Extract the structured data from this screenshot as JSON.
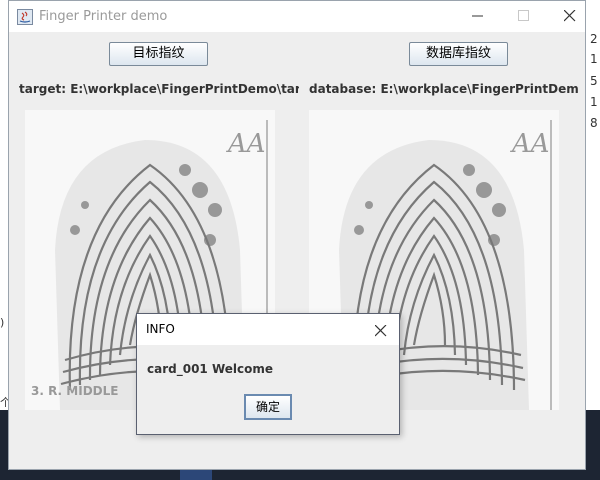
{
  "window": {
    "title": "Finger Printer demo"
  },
  "buttons": {
    "target": "目标指纹",
    "database": "数据库指纹"
  },
  "paths": {
    "target": "target: E:\\workplace\\FingerPrintDemo\\target.png",
    "database": "database: E:\\workplace\\FingerPrintDemo\\data"
  },
  "fingerprint": {
    "corner_mark": "AA",
    "caption": "3. R. MIDDLE"
  },
  "dialog": {
    "title": "INFO",
    "message": "card_001 Welcome",
    "ok_label": "确定"
  },
  "background": {
    "right_digits": [
      "2",
      "1",
      "5",
      "1",
      "8"
    ],
    "left_chars": [
      ")",
      "个"
    ]
  },
  "colors": {
    "titlebar": "#ffffff",
    "window_bg": "#eeeeee",
    "title_text": "#9a9a9a",
    "button_border": "#7a8a99",
    "taskbar": "#1d2533"
  }
}
